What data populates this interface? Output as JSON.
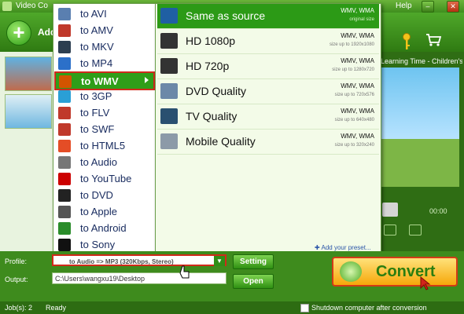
{
  "window": {
    "title": "Video Co",
    "help_label": "Help",
    "minimize_label": "–",
    "close_label": "✕"
  },
  "toolbar": {
    "add_label": "Add"
  },
  "preview": {
    "title": "Learning Time - Children's Son...",
    "time": "00:00"
  },
  "menu_formats": {
    "items": [
      {
        "label": "to AVI",
        "icon": "avi-icon",
        "color": "#5a7fb0"
      },
      {
        "label": "to AMV",
        "icon": "amv-icon",
        "color": "#c0392b"
      },
      {
        "label": "to MKV",
        "icon": "mkv-icon",
        "color": "#2c3e50"
      },
      {
        "label": "to MP4",
        "icon": "mp4-icon",
        "color": "#2c70c9"
      },
      {
        "label": "to WMV",
        "icon": "wmv-icon",
        "color": "#d35400"
      },
      {
        "label": "to 3GP",
        "icon": "3gp-icon",
        "color": "#2a9fd6"
      },
      {
        "label": "to FLV",
        "icon": "flv-icon",
        "color": "#c0392b"
      },
      {
        "label": "to SWF",
        "icon": "swf-icon",
        "color": "#c0392b"
      },
      {
        "label": "to HTML5",
        "icon": "html5-icon",
        "color": "#e44d26"
      },
      {
        "label": "to Audio",
        "icon": "audio-icon",
        "color": "#777777"
      },
      {
        "label": "to YouTube",
        "icon": "youtube-icon",
        "color": "#cc0000"
      },
      {
        "label": "to DVD",
        "icon": "dvd-icon",
        "color": "#222222"
      },
      {
        "label": "to Apple",
        "icon": "apple-icon",
        "color": "#555555"
      },
      {
        "label": "to Android",
        "icon": "android-icon",
        "color": "#2a8c2a"
      },
      {
        "label": "to Sony",
        "icon": "sony-icon",
        "color": "#111111"
      }
    ]
  },
  "menu_quality": {
    "items": [
      {
        "label": "Same as source",
        "format": "WMV, WMA",
        "size": "original size",
        "icon": "film-icon"
      },
      {
        "label": "HD 1080p",
        "format": "WMV, WMA",
        "size": "size up to 1920x1080",
        "icon": "hd1080-icon"
      },
      {
        "label": "HD 720p",
        "format": "WMV, WMA",
        "size": "size up to 1280x720",
        "icon": "hd720-icon"
      },
      {
        "label": "DVD Quality",
        "format": "WMV, WMA",
        "size": "size up to 720x576",
        "icon": "dvd-quality-icon"
      },
      {
        "label": "TV Quality",
        "format": "WMV, WMA",
        "size": "size up to 640x480",
        "icon": "tv-icon"
      },
      {
        "label": "Mobile Quality",
        "format": "WMV, WMA",
        "size": "size up to 320x240",
        "icon": "mobile-icon"
      }
    ],
    "add_preset": "Add your preset..."
  },
  "profile": {
    "label": "Profile:",
    "value": "to Audio => MP3 (320Kbps, Stereo)",
    "setting_label": "Setting"
  },
  "output": {
    "label": "Output:",
    "value": "C:\\Users\\wangxu19\\Desktop",
    "open_label": "Open"
  },
  "convert": {
    "label": "Convert"
  },
  "status": {
    "jobs": "Job(s): 2",
    "state": "Ready",
    "shutdown_label": "Shutdown computer after conversion"
  }
}
